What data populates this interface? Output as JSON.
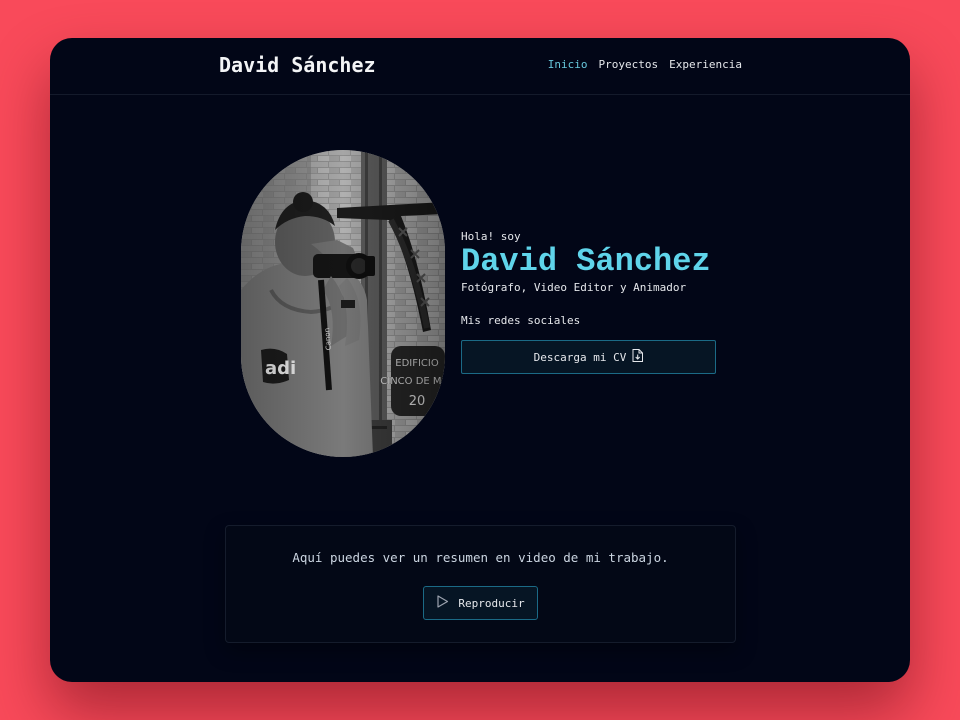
{
  "header": {
    "brand": "David Sánchez",
    "nav": [
      {
        "label": "Inicio",
        "active": true
      },
      {
        "label": "Proyectos",
        "active": false
      },
      {
        "label": "Experiencia",
        "active": false
      }
    ]
  },
  "hero": {
    "greeting": "Hola! soy",
    "name": "David Sánchez",
    "role": "Fotógrafo, Video Editor y Animador",
    "social_label": "Mis redes sociales",
    "cv_button": "Descarga mi CV",
    "cv_icon": "file-download-icon",
    "photo_alt": "Fotógrafo con cámara Canon"
  },
  "video": {
    "text": "Aquí puedes ver un resumen en video de mi trabajo.",
    "button": "Reproducir",
    "button_icon": "play-icon"
  },
  "colors": {
    "background": "#f94a5a",
    "window": "#020617",
    "accent": "#5fd4ea",
    "nav_active": "#67c7dc",
    "button_border": "#1b6a86"
  }
}
